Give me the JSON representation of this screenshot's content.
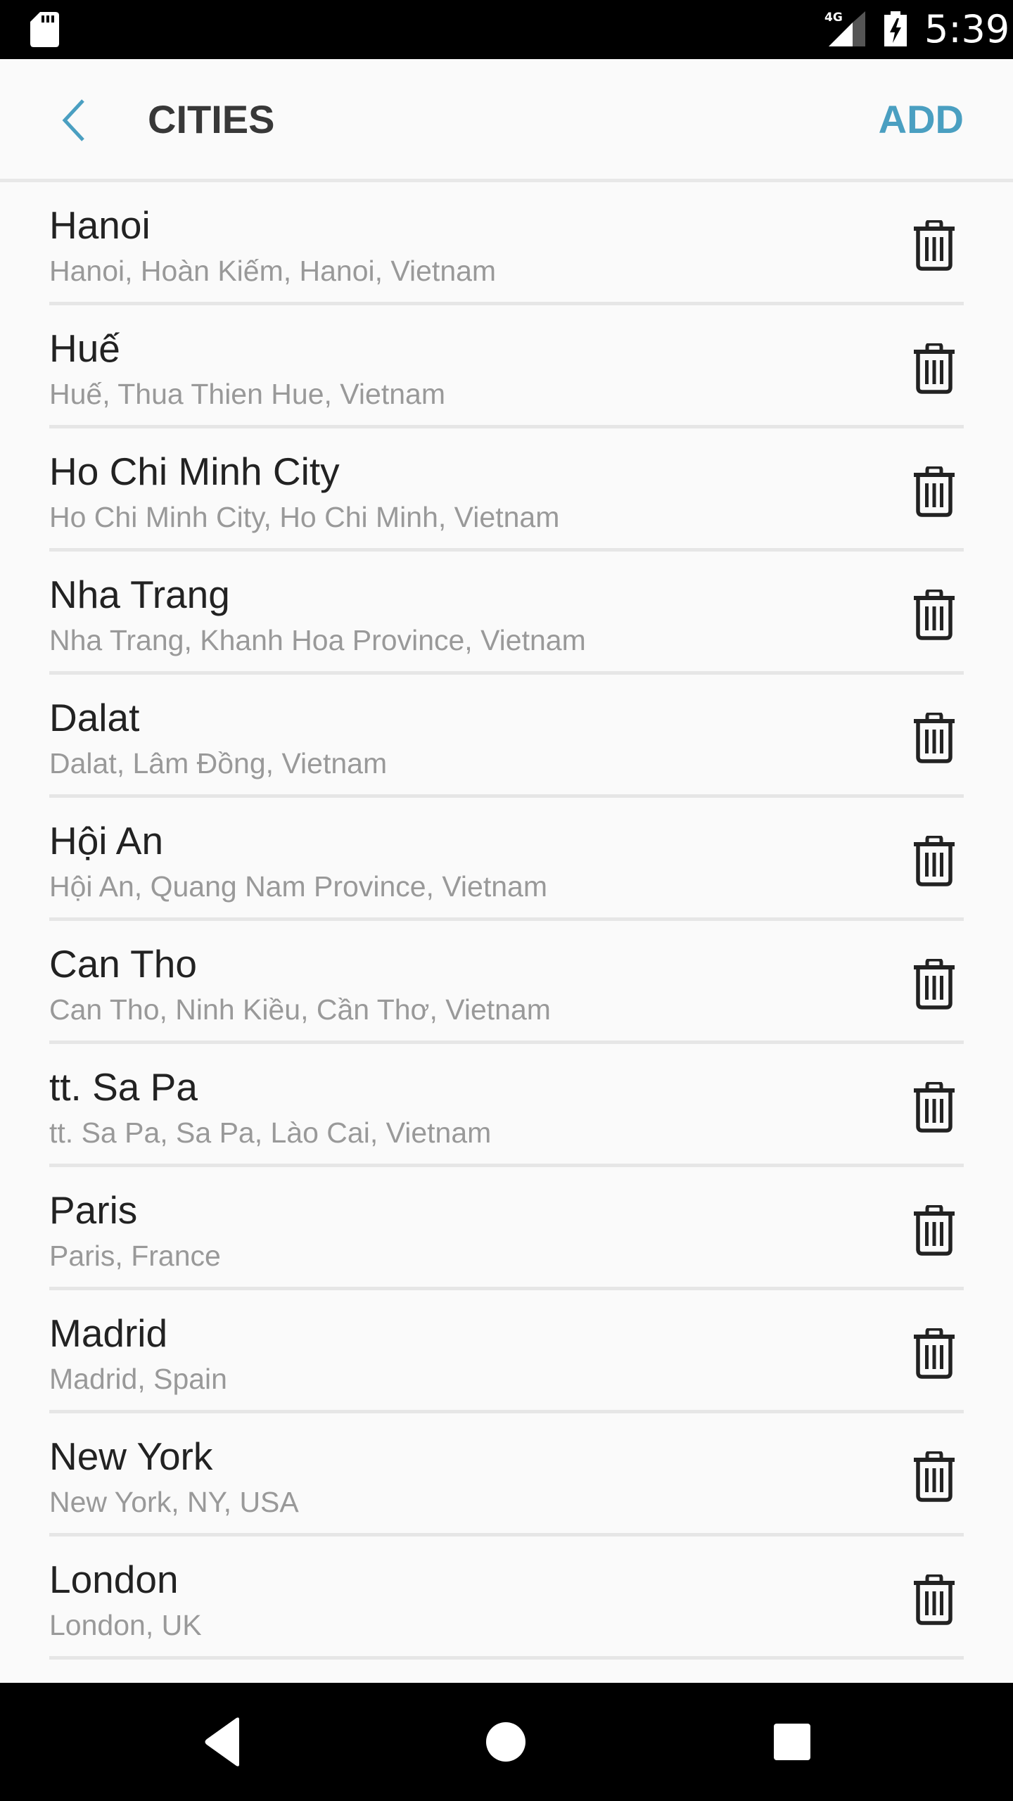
{
  "status_bar": {
    "left_icons": [
      "sd-card-icon"
    ],
    "network_label": "4G",
    "right_icons": [
      "signal-icon",
      "battery-charging-icon"
    ],
    "time": "5:39"
  },
  "app_bar": {
    "back_icon": "chevron-left-icon",
    "title": "CITIES",
    "add_label": "ADD"
  },
  "colors": {
    "accent": "#4a9fc1",
    "title_text": "#383838",
    "primary_text": "#222222",
    "secondary_text": "#999999",
    "divider": "#e6e6e6",
    "background": "#fafafa"
  },
  "cities": [
    {
      "name": "Hanoi",
      "detail": "Hanoi, Hoàn Kiếm, Hanoi, Vietnam",
      "action_icon": "trash-icon"
    },
    {
      "name": "Huế",
      "detail": "Huế, Thua Thien Hue, Vietnam",
      "action_icon": "trash-icon"
    },
    {
      "name": "Ho Chi Minh City",
      "detail": "Ho Chi Minh City, Ho Chi Minh, Vietnam",
      "action_icon": "trash-icon"
    },
    {
      "name": "Nha Trang",
      "detail": "Nha Trang, Khanh Hoa Province, Vietnam",
      "action_icon": "trash-icon"
    },
    {
      "name": "Dalat",
      "detail": "Dalat, Lâm Đồng, Vietnam",
      "action_icon": "trash-icon"
    },
    {
      "name": "Hội An",
      "detail": "Hội An, Quang Nam Province, Vietnam",
      "action_icon": "trash-icon"
    },
    {
      "name": "Can Tho",
      "detail": "Can Tho, Ninh Kiều, Cần Thơ, Vietnam",
      "action_icon": "trash-icon"
    },
    {
      "name": "tt. Sa Pa",
      "detail": "tt. Sa Pa, Sa Pa, Lào Cai, Vietnam",
      "action_icon": "trash-icon"
    },
    {
      "name": "Paris",
      "detail": "Paris, France",
      "action_icon": "trash-icon"
    },
    {
      "name": "Madrid",
      "detail": "Madrid, Spain",
      "action_icon": "trash-icon"
    },
    {
      "name": "New York",
      "detail": "New York, NY, USA",
      "action_icon": "trash-icon"
    },
    {
      "name": "London",
      "detail": "London, UK",
      "action_icon": "trash-icon"
    }
  ],
  "nav_bar": {
    "buttons": [
      "back-triangle-icon",
      "home-circle-icon",
      "recents-square-icon"
    ]
  }
}
